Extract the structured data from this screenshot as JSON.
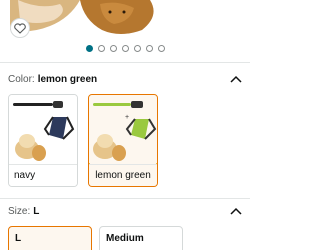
{
  "carousel": {
    "count": 7,
    "active": 0
  },
  "color": {
    "label": "Color:",
    "value": "lemon green",
    "options": [
      {
        "label": "navy",
        "accent": "#2d3a5c",
        "selected": false
      },
      {
        "label": "lemon green",
        "accent": "#9ac93f",
        "selected": true
      }
    ]
  },
  "size": {
    "label": "Size:",
    "value": "L",
    "options": [
      {
        "label": "L",
        "selected": true
      },
      {
        "label": "Medium",
        "selected": false
      }
    ]
  },
  "colors": {
    "accent_dot": "#007185",
    "selected_border": "#e77600"
  }
}
